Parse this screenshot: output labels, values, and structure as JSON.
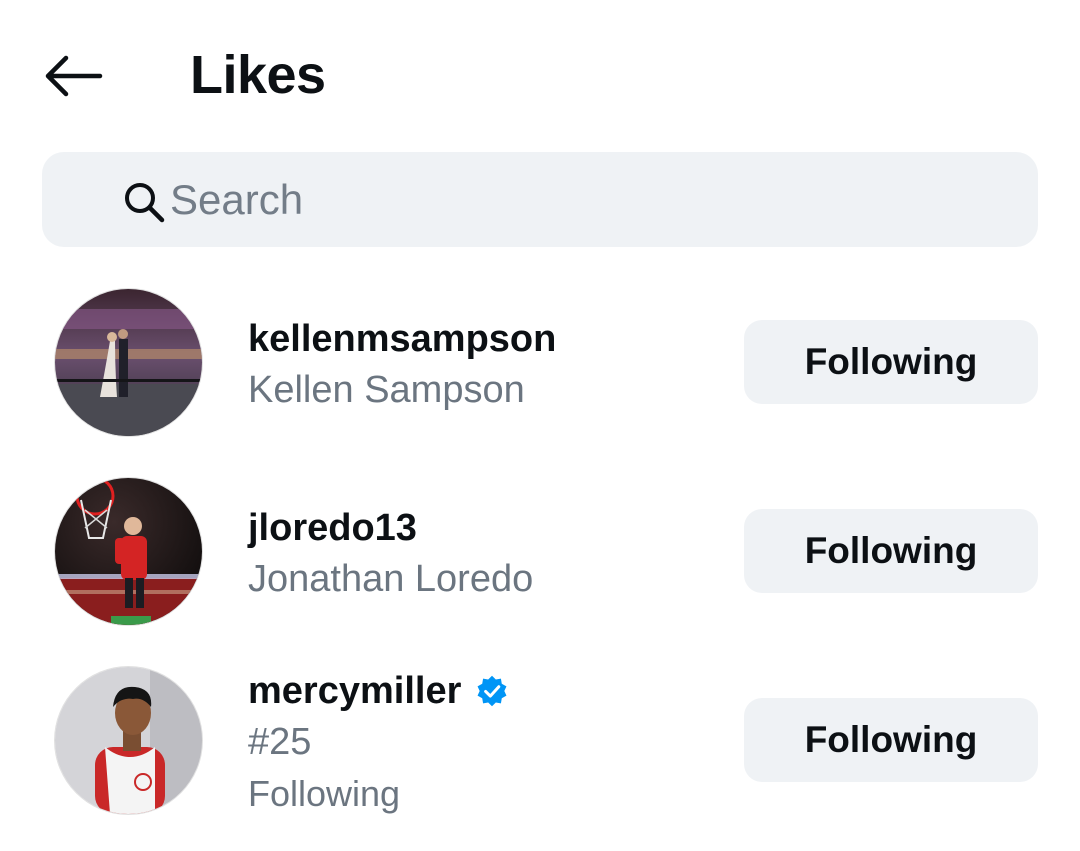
{
  "header": {
    "title": "Likes",
    "back_icon": "arrow-left-icon"
  },
  "search": {
    "icon": "search-icon",
    "placeholder": "Search",
    "value": ""
  },
  "users": [
    {
      "username": "kellenmsampson",
      "full_name": "Kellen Sampson",
      "verified": false,
      "button_label": "Following"
    },
    {
      "username": "jloredo13",
      "full_name": "Jonathan Loredo",
      "verified": false,
      "button_label": "Following"
    },
    {
      "username": "mercymiller",
      "full_name": "#25",
      "relationship": "Following",
      "verified": true,
      "verified_icon": "verified-badge-icon",
      "verified_color": "#0095f6",
      "button_label": "Following"
    }
  ],
  "colors": {
    "text_primary": "#0c1014",
    "text_secondary": "#6b7580",
    "button_bg": "#eff2f5",
    "search_bg": "#eff2f5"
  }
}
